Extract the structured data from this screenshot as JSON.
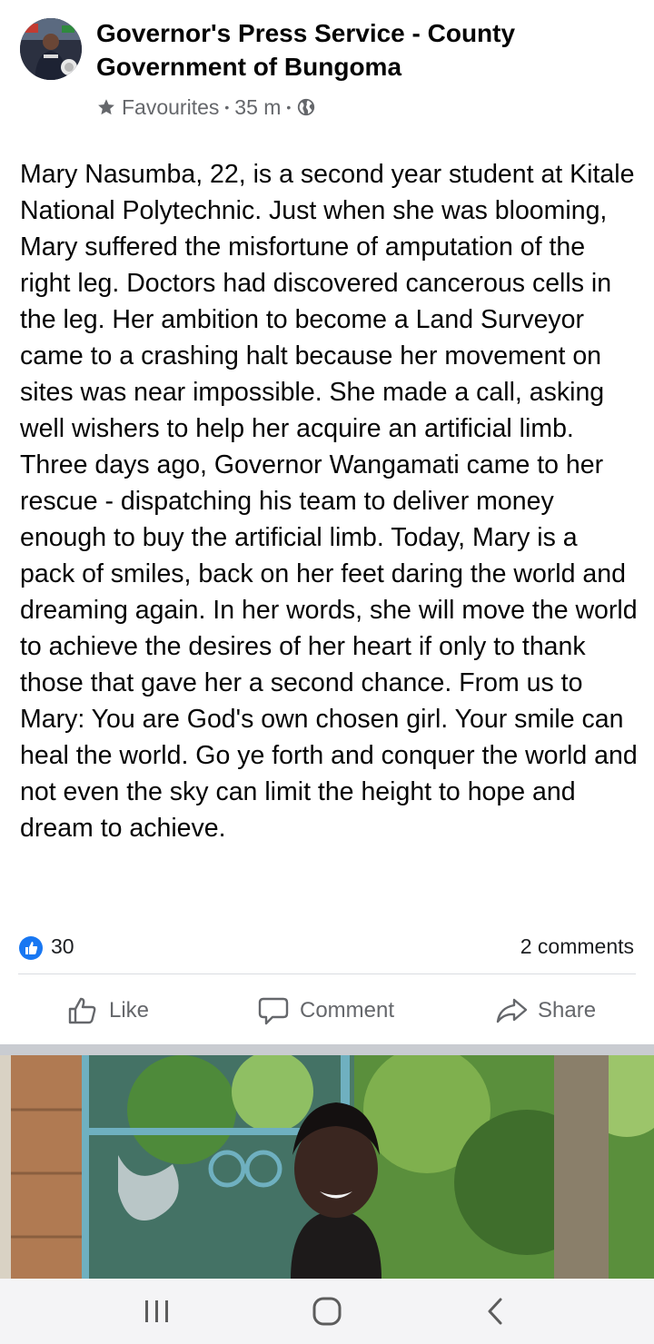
{
  "post": {
    "page_name": "Governor's Press Service - County Government of Bungoma",
    "audience_label": "Favourites",
    "time": "35 m",
    "separator": "•",
    "icons": {
      "audience": "star-icon",
      "privacy": "globe-icon"
    },
    "body": "Mary Nasumba, 22, is a second year student at Kitale National Polytechnic. Just when she was blooming, Mary suffered the misfortune of amputation of the right leg. Doctors had discovered cancerous cells in the leg. Her ambition to become a Land Surveyor came to a crashing halt because her movement on sites was near impossible. She made a call, asking well wishers to help her acquire an artificial limb. Three days ago, Governor Wangamati came to her rescue - dispatching his team to deliver money enough to buy the artificial limb. Today, Mary is a pack of smiles, back on her feet daring the world and dreaming again. In her words, she will move the world to achieve the desires of her heart if only to thank those that gave her a second chance. From us to Mary: You are God's own chosen girl. Your smile can heal the world. Go ye forth and conquer the world and not even the sky can limit the height to hope and dream to achieve."
  },
  "engagement": {
    "like_count": "30",
    "comments_label": "2 comments"
  },
  "actions": {
    "like_label": "Like",
    "comment_label": "Comment",
    "share_label": "Share"
  },
  "colors": {
    "facebook_blue": "#1877f2",
    "muted_text": "#65676b",
    "separator_gray": "#c9ccd1"
  }
}
